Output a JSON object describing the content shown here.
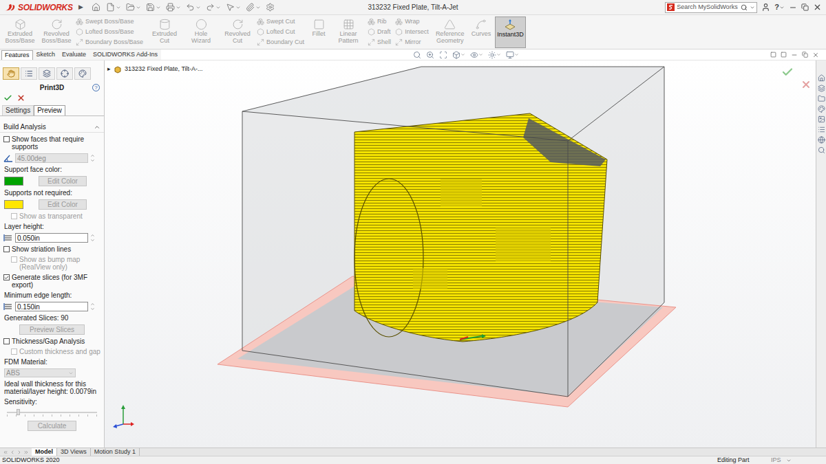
{
  "app": {
    "logo": "SOLIDWORKS",
    "menu_arrow": "▶"
  },
  "window": {
    "title": "313232 Fixed Plate, Tilt-A-Jet"
  },
  "search": {
    "placeholder": "Search MySolidWorks"
  },
  "help": "?",
  "ribbon": [
    {
      "kind": "large",
      "label": "Extruded Boss/Base",
      "disabled": true,
      "selected": false
    },
    {
      "kind": "large",
      "label": "Revolved Boss/Base",
      "disabled": true,
      "selected": false
    },
    {
      "kind": "stack",
      "items": [
        {
          "label": "Swept Boss/Base",
          "disabled": true
        },
        {
          "label": "Lofted Boss/Base",
          "disabled": true
        },
        {
          "label": "Boundary Boss/Base",
          "disabled": true
        }
      ]
    },
    {
      "kind": "large",
      "label": "Extruded Cut",
      "disabled": true,
      "selected": false
    },
    {
      "kind": "large",
      "label": "Hole Wizard",
      "disabled": true,
      "selected": false
    },
    {
      "kind": "large",
      "label": "Revolved Cut",
      "disabled": true,
      "selected": false
    },
    {
      "kind": "stack",
      "items": [
        {
          "label": "Swept Cut",
          "disabled": true
        },
        {
          "label": "Lofted Cut",
          "disabled": true
        },
        {
          "label": "Boundary Cut",
          "disabled": true
        }
      ]
    },
    {
      "kind": "large",
      "label": "Fillet",
      "disabled": true,
      "selected": false
    },
    {
      "kind": "large",
      "label": "Linear Pattern",
      "disabled": true,
      "selected": false
    },
    {
      "kind": "stack",
      "items": [
        {
          "label": "Rib",
          "disabled": true
        },
        {
          "label": "Draft",
          "disabled": true
        },
        {
          "label": "Shell",
          "disabled": true
        }
      ]
    },
    {
      "kind": "stack",
      "items": [
        {
          "label": "Wrap",
          "disabled": true
        },
        {
          "label": "Intersect",
          "disabled": true
        },
        {
          "label": "Mirror",
          "disabled": true
        }
      ]
    },
    {
      "kind": "large",
      "label": "Reference Geometry",
      "disabled": true,
      "selected": false
    },
    {
      "kind": "large",
      "label": "Curves",
      "disabled": true,
      "selected": false
    },
    {
      "kind": "large",
      "label": "Instant3D",
      "disabled": false,
      "selected": true
    }
  ],
  "command_tabs": [
    {
      "label": "Features",
      "selected": true
    },
    {
      "label": "Sketch",
      "selected": false
    },
    {
      "label": "Evaluate",
      "selected": false
    },
    {
      "label": "SOLIDWORKS Add-Ins",
      "selected": false
    }
  ],
  "panel_tabs": [
    {
      "selected": true
    },
    {
      "selected": false
    },
    {
      "selected": false
    },
    {
      "selected": false
    },
    {
      "selected": false
    }
  ],
  "property_manager": {
    "title": "Print3D",
    "help": "?",
    "tabs": [
      {
        "label": "Settings",
        "selected": false
      },
      {
        "label": "Preview",
        "selected": true
      }
    ],
    "section": {
      "title": "Build Analysis",
      "expanded": true
    },
    "rows": [
      {
        "kind": "checkbox",
        "label": "Show faces that require supports",
        "checked": false,
        "disabled": false
      },
      {
        "kind": "angle-field",
        "value": "45.00deg",
        "disabled": true
      },
      {
        "kind": "label",
        "text": "Support face color:"
      },
      {
        "kind": "color",
        "color": "#00a300",
        "button": "Edit Color",
        "disabled": true
      },
      {
        "kind": "label",
        "text": "Supports not required:"
      },
      {
        "kind": "color",
        "color": "#ffe600",
        "button": "Edit Color",
        "disabled": true
      },
      {
        "kind": "subcheckbox",
        "label": "Show as transparent",
        "checked": false,
        "disabled": true
      },
      {
        "kind": "label",
        "text": "Layer height:"
      },
      {
        "kind": "spin-field",
        "value": "0.050in",
        "disabled": false
      },
      {
        "kind": "checkbox",
        "label": "Show striation lines",
        "checked": false,
        "disabled": false
      },
      {
        "kind": "subcheckbox",
        "label": "Show as bump map (RealView only)",
        "checked": false,
        "disabled": true
      },
      {
        "kind": "checkbox",
        "label": "Generate slices (for 3MF export)",
        "checked": true,
        "disabled": false
      },
      {
        "kind": "label",
        "text": "Minimum edge length:"
      },
      {
        "kind": "spin-field",
        "value": "0.150in",
        "disabled": false
      },
      {
        "kind": "label",
        "text": "Generated Slices: 90"
      },
      {
        "kind": "button",
        "label": "Preview Slices",
        "disabled": true
      },
      {
        "kind": "checkbox",
        "label": "Thickness/Gap Analysis",
        "checked": false,
        "disabled": false
      },
      {
        "kind": "subcheckbox",
        "label": "Custom thickness and gap",
        "checked": false,
        "disabled": true
      },
      {
        "kind": "label",
        "text": "FDM Material:"
      },
      {
        "kind": "select",
        "value": "ABS",
        "disabled": true
      },
      {
        "kind": "label",
        "text": "Ideal wall thickness for this material/layer height: 0.0079in"
      },
      {
        "kind": "label",
        "text": "Sensitivity:"
      },
      {
        "kind": "slider",
        "level": 0.12,
        "disabled": true
      },
      {
        "kind": "button",
        "label": "Calculate",
        "disabled": true
      }
    ]
  },
  "feature_tree": {
    "toggle": "▸",
    "label": "313232 Fixed Plate, Tilt-A-..."
  },
  "bottom_tabs": [
    {
      "label": "Model",
      "selected": true
    },
    {
      "label": "3D Views",
      "selected": false
    },
    {
      "label": "Motion Study 1",
      "selected": false
    }
  ],
  "status_bar": {
    "version": "SOLIDWORKS 2020",
    "mode": "Editing Part",
    "units": "IPS"
  }
}
